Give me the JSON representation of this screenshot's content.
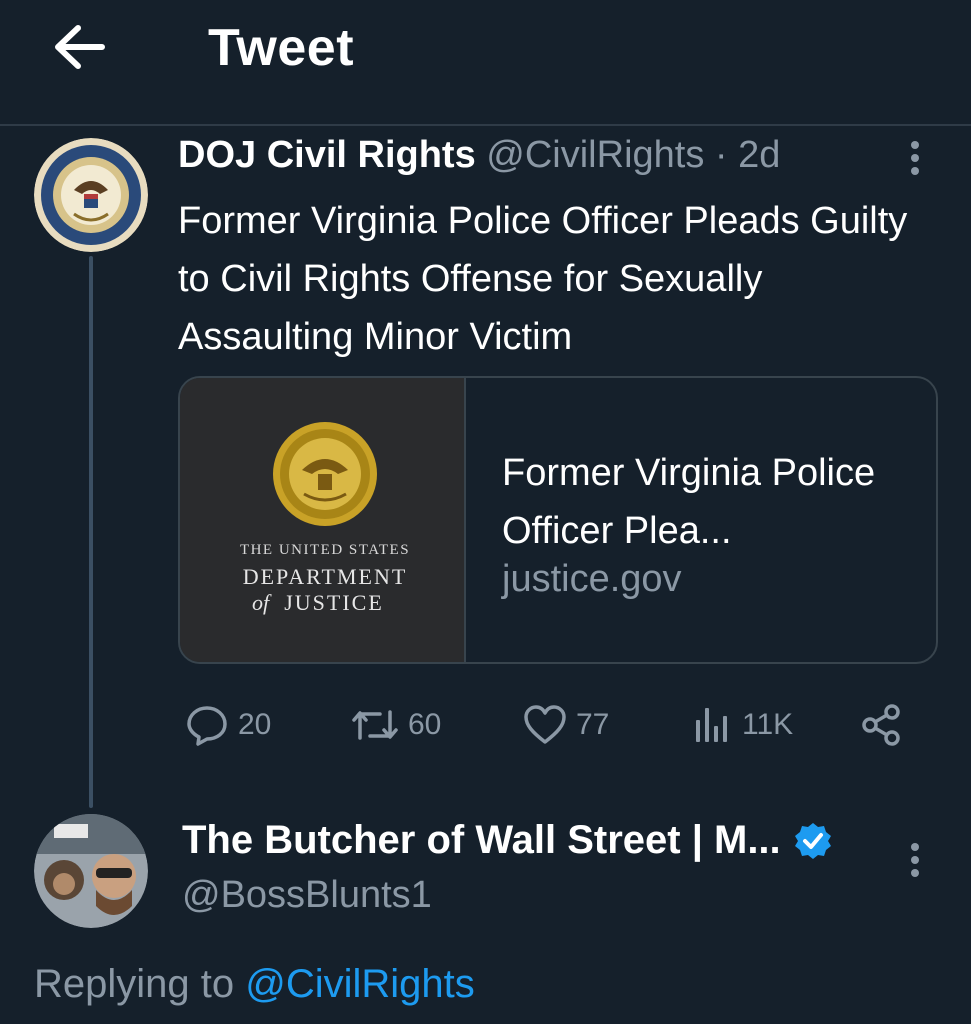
{
  "header": {
    "title": "Tweet"
  },
  "tweet": {
    "author_name": "DOJ Civil Rights",
    "handle": "@CivilRights",
    "separator": "·",
    "time": "2d",
    "text": "Former Virginia Police Officer Pleads Guilty to Civil Rights Offense for Sexually Assaulting Minor Victim",
    "card": {
      "logo_line1": "THE UNITED STATES",
      "logo_line2": "DEPARTMENT",
      "logo_line3_prefix": "of",
      "logo_line3": "JUSTICE",
      "title": "Former Virginia Police Officer Plea...",
      "domain": "justice.gov"
    },
    "stats": {
      "replies": "20",
      "retweets": "60",
      "likes": "77",
      "views": "11K"
    }
  },
  "reply": {
    "author_name": "The Butcher of Wall Street | M...",
    "handle": "@BossBlunts1",
    "replying_prefix": "Replying to",
    "replying_to": "@CivilRights"
  },
  "colors": {
    "background": "#15202b",
    "accent": "#1d9bf0",
    "secondary_text": "#8b98a5",
    "border": "#38444d"
  }
}
